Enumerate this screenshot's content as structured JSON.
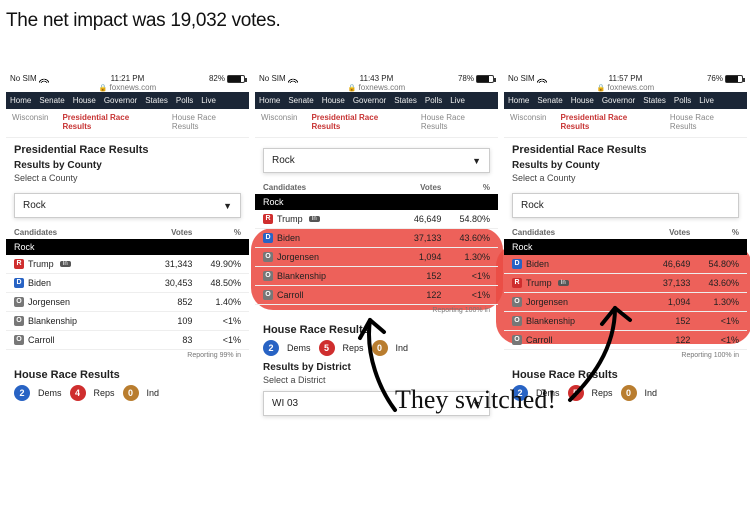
{
  "headline": "The net impact was 19,032 votes.",
  "annotation_text": "They switched!",
  "status_nosim": "No SIM",
  "url_label": "foxnews.com",
  "nav": {
    "home": "Home",
    "senate": "Senate",
    "house": "House",
    "governor": "Governor",
    "states": "States",
    "polls": "Polls",
    "live": "Live"
  },
  "subnav": {
    "wisconsin": "Wisconsin",
    "pres": "Presidential Race Results",
    "house": "House Race Results"
  },
  "titles": {
    "pres": "Presidential Race Results",
    "by_county": "Results by County",
    "select_county": "Select a County",
    "house": "House Race Results",
    "by_district": "Results by District",
    "select_district": "Select a District"
  },
  "select_rock": "Rock",
  "select_wi03": "WI 03",
  "thead": {
    "cand": "Candidates",
    "votes": "Votes",
    "pct": "%"
  },
  "county_row": "Rock",
  "house": {
    "dems_label": "Dems",
    "reps_label": "Reps",
    "ind_label": "Ind"
  },
  "phone1": {
    "time": "11:21 PM",
    "batt": "82%",
    "batt_fill": 82,
    "reporting": "Reporting 99% in",
    "rows": [
      {
        "p": "R",
        "name": "Trump",
        "inc": "In",
        "votes": "31,343",
        "pct": "49.90%"
      },
      {
        "p": "D",
        "name": "Biden",
        "inc": "",
        "votes": "30,453",
        "pct": "48.50%"
      },
      {
        "p": "O",
        "name": "Jorgensen",
        "inc": "",
        "votes": "852",
        "pct": "1.40%"
      },
      {
        "p": "O",
        "name": "Blankenship",
        "inc": "",
        "votes": "109",
        "pct": "<1%"
      },
      {
        "p": "O",
        "name": "Carroll",
        "inc": "",
        "votes": "83",
        "pct": "<1%"
      }
    ],
    "dems": "2",
    "reps": "4",
    "ind": "0"
  },
  "phone2": {
    "time": "11:43 PM",
    "batt": "78%",
    "batt_fill": 78,
    "reporting": "Reporting 100% in",
    "rows": [
      {
        "p": "R",
        "name": "Trump",
        "inc": "In",
        "votes": "46,649",
        "pct": "54.80%"
      },
      {
        "p": "D",
        "name": "Biden",
        "inc": "",
        "votes": "37,133",
        "pct": "43.60%"
      },
      {
        "p": "O",
        "name": "Jorgensen",
        "inc": "",
        "votes": "1,094",
        "pct": "1.30%"
      },
      {
        "p": "O",
        "name": "Blankenship",
        "inc": "",
        "votes": "152",
        "pct": "<1%"
      },
      {
        "p": "O",
        "name": "Carroll",
        "inc": "",
        "votes": "122",
        "pct": "<1%"
      }
    ],
    "dems": "2",
    "reps": "5",
    "ind": "0"
  },
  "phone3": {
    "time": "11:57 PM",
    "batt": "76%",
    "batt_fill": 76,
    "reporting": "Reporting 100% in",
    "rows": [
      {
        "p": "D",
        "name": "Biden",
        "inc": "",
        "votes": "46,649",
        "pct": "54.80%"
      },
      {
        "p": "R",
        "name": "Trump",
        "inc": "In",
        "votes": "37,133",
        "pct": "43.60%"
      },
      {
        "p": "O",
        "name": "Jorgensen",
        "inc": "",
        "votes": "1,094",
        "pct": "1.30%"
      },
      {
        "p": "O",
        "name": "Blankenship",
        "inc": "",
        "votes": "152",
        "pct": "<1%"
      },
      {
        "p": "O",
        "name": "Carroll",
        "inc": "",
        "votes": "122",
        "pct": "<1%"
      }
    ],
    "dems": "2",
    "reps": "5",
    "ind": "0"
  }
}
